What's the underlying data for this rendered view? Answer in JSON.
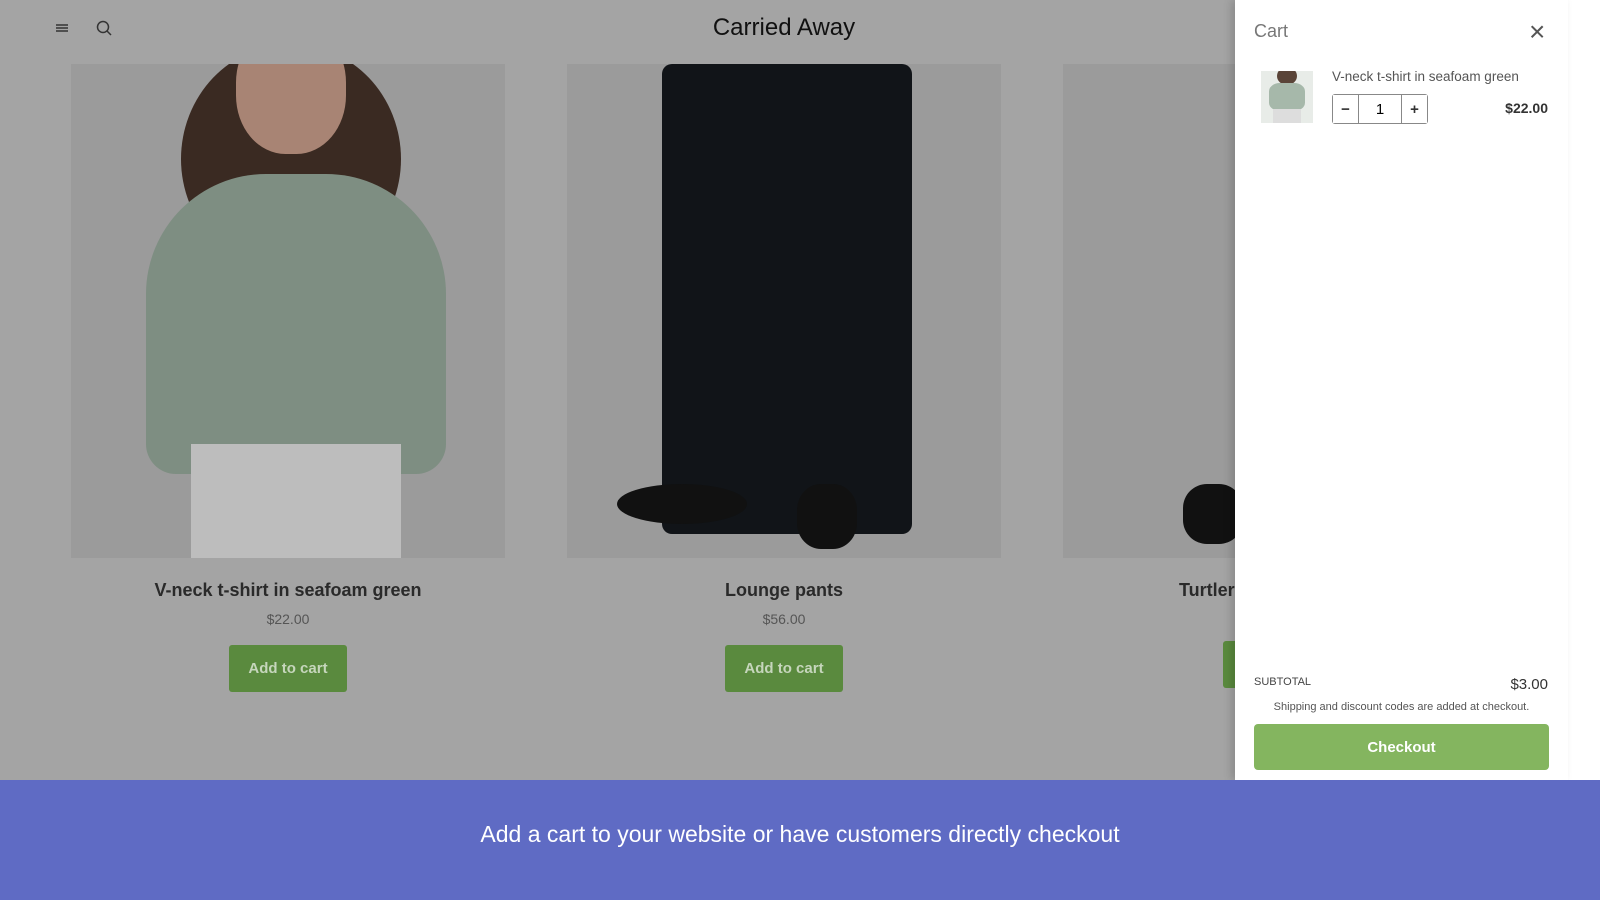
{
  "store": {
    "title": "Carried Away",
    "products": [
      {
        "name": "V-neck t-shirt in seafoam green",
        "price": "$22.00",
        "button": "Add to cart"
      },
      {
        "name": "Lounge pants",
        "price": "$56.00",
        "button": "Add to cart"
      },
      {
        "name": "Turtler",
        "price": "",
        "button": ""
      }
    ]
  },
  "cart": {
    "title": "Cart",
    "close": "×",
    "item": {
      "name": "V-neck t-shirt in seafoam green",
      "quantity": "1",
      "price": "$22.00",
      "minus": "−",
      "plus": "+"
    },
    "subtotal_label": "SUBTOTAL",
    "subtotal": "$3.00",
    "note": "Shipping and discount codes are added at checkout.",
    "checkout": "Checkout"
  },
  "banner": "Add a cart to your website or have customers directly checkout",
  "colors": {
    "accent": "#84b55f",
    "banner": "#5f6bc4"
  }
}
